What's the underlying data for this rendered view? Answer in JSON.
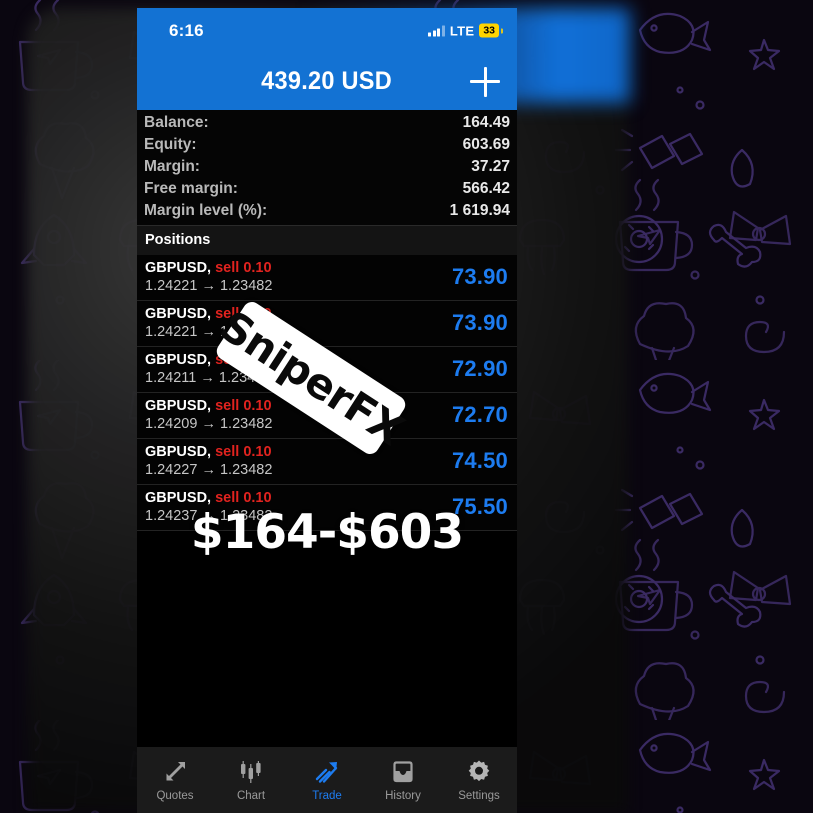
{
  "status_bar": {
    "time": "6:16",
    "network_label": "LTE",
    "battery_percent": "33",
    "signal_icon": "signal-bars-icon"
  },
  "header": {
    "title": "439.20 USD",
    "add_icon": "plus-icon"
  },
  "account_summary": [
    {
      "label": "Balance:",
      "value": "164.49"
    },
    {
      "label": "Equity:",
      "value": "603.69"
    },
    {
      "label": "Margin:",
      "value": "37.27"
    },
    {
      "label": "Free margin:",
      "value": "566.42"
    },
    {
      "label": "Margin level (%):",
      "value": "1 619.94"
    }
  ],
  "positions": {
    "section_title": "Positions",
    "rows": [
      {
        "symbol": "GBPUSD,",
        "side": "sell 0.10",
        "open_price": "1.24221",
        "arrow": "→",
        "current_price": "1.23482",
        "profit": "73.90"
      },
      {
        "symbol": "GBPUSD,",
        "side": "sell 0.10",
        "open_price": "1.24221",
        "arrow": "→",
        "current_price": "1.23482",
        "profit": "73.90"
      },
      {
        "symbol": "GBPUSD,",
        "side": "sell 0.10",
        "open_price": "1.24211",
        "arrow": "→",
        "current_price": "1.23482",
        "profit": "72.90"
      },
      {
        "symbol": "GBPUSD,",
        "side": "sell 0.10",
        "open_price": "1.24209",
        "arrow": "→",
        "current_price": "1.23482",
        "profit": "72.70"
      },
      {
        "symbol": "GBPUSD,",
        "side": "sell 0.10",
        "open_price": "1.24227",
        "arrow": "→",
        "current_price": "1.23482",
        "profit": "74.50"
      },
      {
        "symbol": "GBPUSD,",
        "side": "sell 0.10",
        "open_price": "1.24237",
        "arrow": "→",
        "current_price": "1.23482",
        "profit": "75.50"
      }
    ]
  },
  "tabbar": {
    "tabs": [
      {
        "label": "Quotes",
        "icon": "quotes-arrows-icon",
        "active": false
      },
      {
        "label": "Chart",
        "icon": "candlestick-icon",
        "active": false
      },
      {
        "label": "Trade",
        "icon": "trend-arrow-icon",
        "active": true
      },
      {
        "label": "History",
        "icon": "inbox-tray-icon",
        "active": false
      },
      {
        "label": "Settings",
        "icon": "gear-icon",
        "active": false
      }
    ]
  },
  "overlays": {
    "watermark_text": "SniperFX",
    "headline_text": "$164-$603"
  },
  "colors": {
    "header_blue": "#1372d3",
    "profit_blue": "#1d7cf0",
    "sell_red": "#e1231f",
    "battery_yellow": "#ffd400",
    "screen_black": "#000000"
  }
}
